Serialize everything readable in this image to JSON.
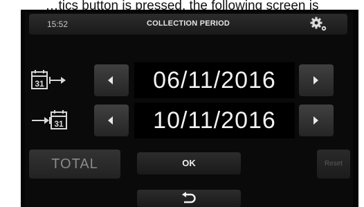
{
  "caption": "…tics button is pressed, the following screen is",
  "header": {
    "time": "15:52",
    "title": "COLLECTION PERIOD",
    "settings_icon": "gear-icon"
  },
  "start_date": {
    "icon": "calendar-start-icon",
    "calendar_day": "31",
    "value": "06/11/2016"
  },
  "end_date": {
    "icon": "calendar-end-icon",
    "calendar_day": "31",
    "value": "10/11/2016"
  },
  "buttons": {
    "total": "TOTAL",
    "ok": "OK",
    "reset": "Reset",
    "back_icon": "back-arrow-icon"
  },
  "colors": {
    "background": "#0a0a0a",
    "text": "#f2f2f2",
    "button": "#333333"
  }
}
